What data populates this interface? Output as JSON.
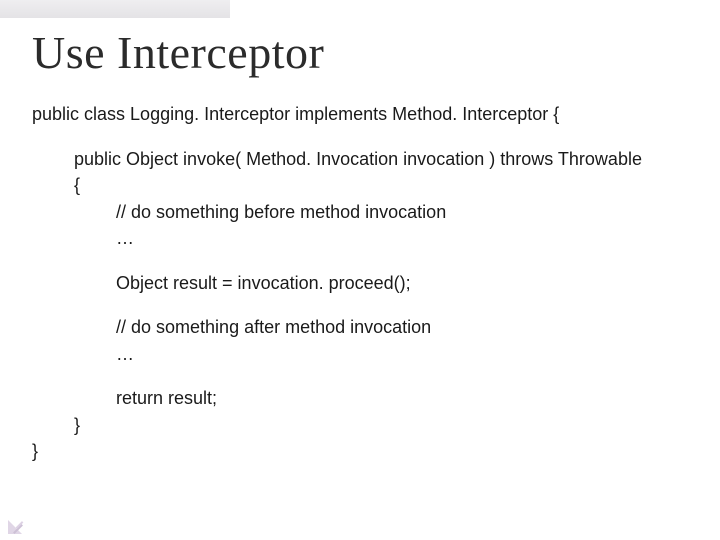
{
  "slide": {
    "title": "Use Interceptor",
    "code": {
      "l0": "public class Logging. Interceptor implements Method. Interceptor {",
      "l1": "public Object invoke( Method. Invocation invocation ) throws Throwable",
      "l1b": "{",
      "l2": "// do something before method invocation",
      "l3": "…",
      "l4": "Object result = invocation. proceed();",
      "l5": "// do something after method invocation",
      "l6": "…",
      "l7": "return result;",
      "l8": "}",
      "l9": "}"
    }
  }
}
